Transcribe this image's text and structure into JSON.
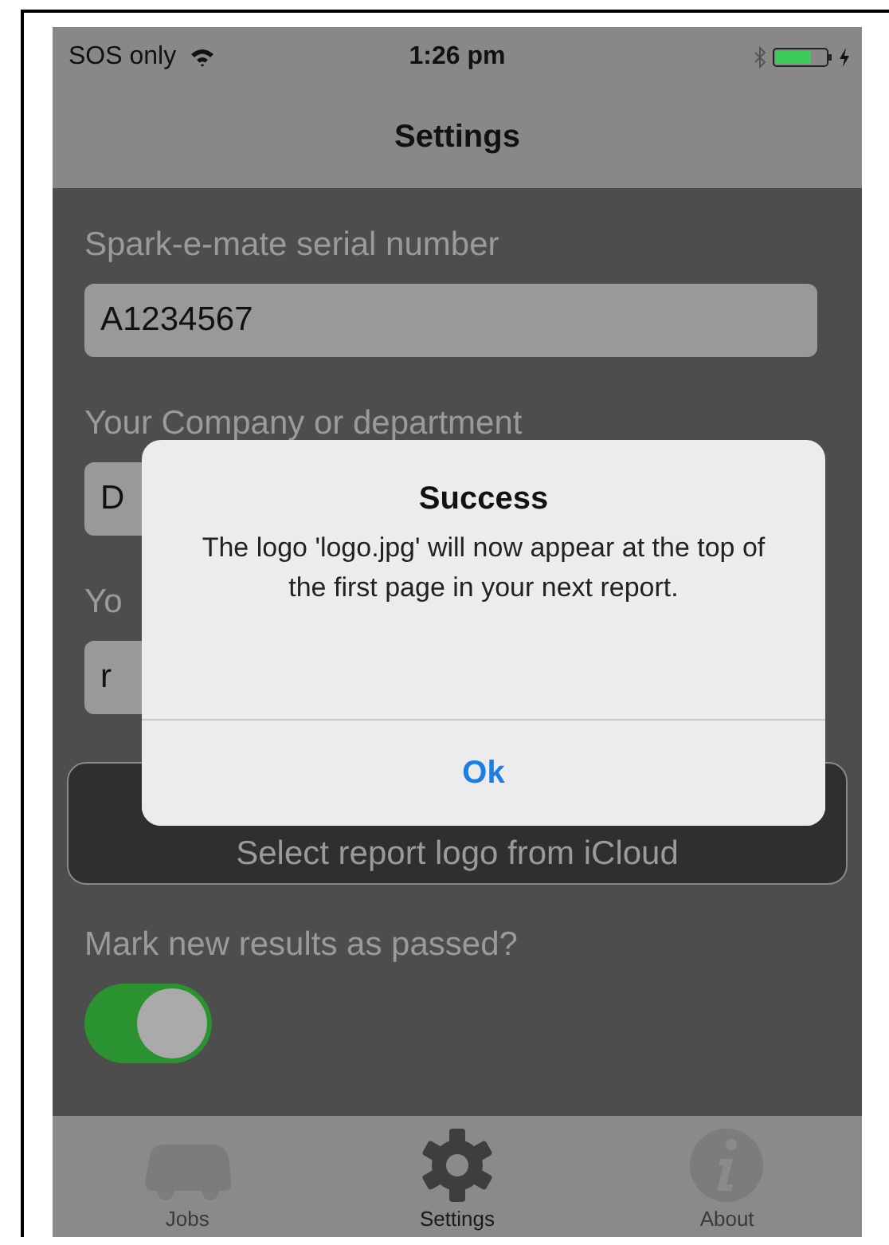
{
  "status_bar": {
    "carrier": "SOS only",
    "time": "1:26 pm",
    "charging": true
  },
  "nav_bar": {
    "title": "Settings"
  },
  "fields": [
    {
      "label": "Spark-e-mate serial number",
      "value": "A1234567"
    },
    {
      "label": "Your Company or department",
      "value": "D"
    },
    {
      "label": "Yo",
      "value": "r"
    }
  ],
  "logo_button": {
    "label": "Select report logo from iCloud"
  },
  "toggle": {
    "label": "Mark new results as passed?",
    "on": true
  },
  "dialog": {
    "title": "Success",
    "message": "The logo 'logo.jpg' will now appear at the top of the first page in your next report.",
    "button": "Ok"
  },
  "tabs": [
    {
      "label": "Jobs",
      "kind": "van",
      "selected": false
    },
    {
      "label": "Settings",
      "kind": "gear",
      "selected": true
    },
    {
      "label": "About",
      "kind": "info",
      "selected": false
    }
  ]
}
